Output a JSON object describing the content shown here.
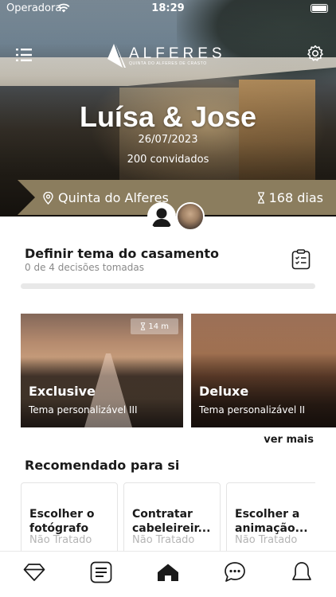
{
  "status_bar": {
    "carrier": "Operadora",
    "time": "18:29"
  },
  "header": {
    "logo_name": "ALFERES",
    "logo_sub": "QUINTA DO ALFERES DE CRASTO",
    "couple": "Luísa & Jose",
    "date": "26/07/2023",
    "guests": "200 convidados",
    "venue": "Quinta do Alferes",
    "days_left": "168 dias"
  },
  "theme": {
    "title": "Definir tema do casamento",
    "subtitle": "0 de 4 decisões tomadas",
    "progress": 0,
    "cards": [
      {
        "title": "Exclusive",
        "subtitle": "Tema personalizável III",
        "badge": "14 m"
      },
      {
        "title": "Deluxe",
        "subtitle": "Tema personalizável II",
        "badge": ""
      }
    ],
    "see_more": "ver mais"
  },
  "recommended": {
    "title": "Recomendado para si",
    "items": [
      {
        "name": "Escolher o fotógrafo",
        "status": "Não Tratado"
      },
      {
        "name": "Contratar cabeleireir...",
        "status": "Não Tratado"
      },
      {
        "name": "Escolher a animação...",
        "status": "Não Tratado"
      }
    ]
  },
  "colors": {
    "accent": "#8b7d5e",
    "muted": "#8a8a8a"
  },
  "tabs": [
    "diamond-icon",
    "checklist-icon",
    "home-icon",
    "chat-icon",
    "bell-icon"
  ]
}
